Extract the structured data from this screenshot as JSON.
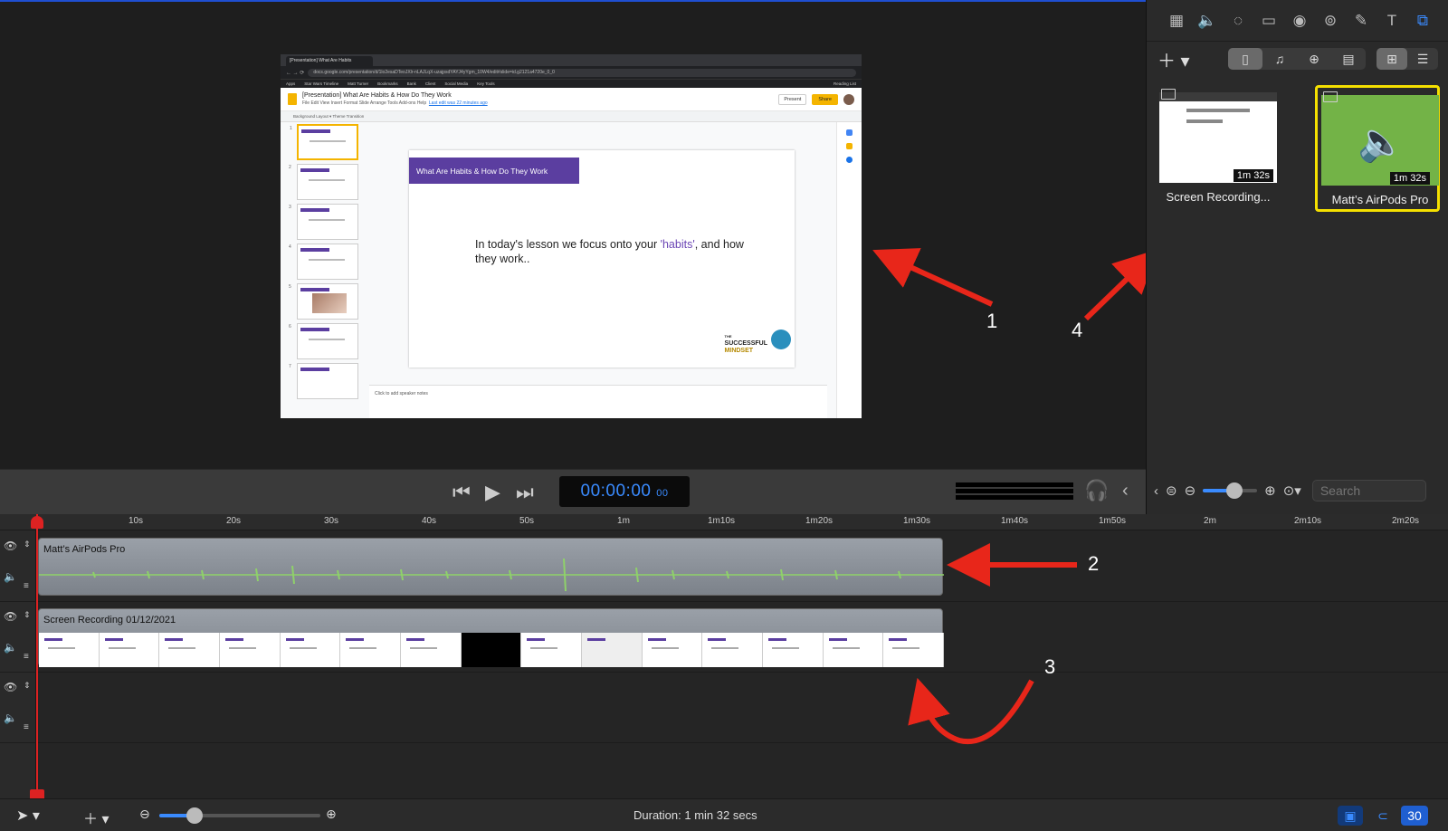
{
  "browser": {
    "tab_title": "[Presentation] What Are Habits",
    "url": "docs.google.com/presentation/d/1lo2esaDTeoJXlr-nLAJLqX-uzajpsdYAYJ4yYgm_10W4/edit#slide=id.g2121a4720e_0_0",
    "bookmarks": [
      "Apps",
      "Star Wars Timeline",
      "Matt Turner",
      "Bookmarks",
      "Bank",
      "Client",
      "Social Media",
      "Key Tools",
      "Reading List"
    ]
  },
  "slides": {
    "doc_title": "[Presentation] What Are Habits & How Do They Work",
    "menu": "File  Edit  View  Insert  Format  Slide  Arrange  Tools  Add-ons  Help",
    "last_edit": "Last edit was 22 minutes ago",
    "present_label": "Present",
    "share_label": "Share",
    "toolbar_text": "Background   Layout ▾   Theme   Transition",
    "slide_title": "What Are Habits & How Do They Work",
    "body_prefix": "In today's lesson we focus onto your ",
    "body_highlight": "'habits'",
    "body_suffix": ", and how they work..",
    "logo_top": "THE",
    "logo_mid": "SUCCESSFUL",
    "logo_bottom": "MINDSET",
    "notes_placeholder": "Click to add speaker notes",
    "thumb_numbers": [
      "1",
      "2",
      "3",
      "4",
      "5",
      "6",
      "7"
    ]
  },
  "annotations": [
    "1",
    "2",
    "3",
    "4"
  ],
  "transport": {
    "timecode_main": "00:00:00",
    "timecode_frames": "00"
  },
  "panel": {
    "media": [
      {
        "label": "Screen Recording...",
        "duration": "1m 32s"
      },
      {
        "label": "Matt’s AirPods Pro",
        "duration": "1m 32s"
      }
    ],
    "search_placeholder": "Search"
  },
  "timeline": {
    "ticks": [
      "10s",
      "20s",
      "30s",
      "40s",
      "50s",
      "1m",
      "1m10s",
      "1m20s",
      "1m30s",
      "1m40s",
      "1m50s",
      "2m",
      "2m10s",
      "2m20s"
    ],
    "tracks": [
      {
        "name": "Matt’s AirPods Pro"
      },
      {
        "name": "Screen Recording 01/12/2021"
      }
    ]
  },
  "status": {
    "duration": "Duration: 1 min 32 secs",
    "fps": "30"
  },
  "colors": {
    "accent_blue": "#3a8bff",
    "playhead_red": "#dd2222",
    "selection_yellow": "#f5e000",
    "slide_purple": "#5b3ea0",
    "arrow_red": "#e8261a"
  }
}
